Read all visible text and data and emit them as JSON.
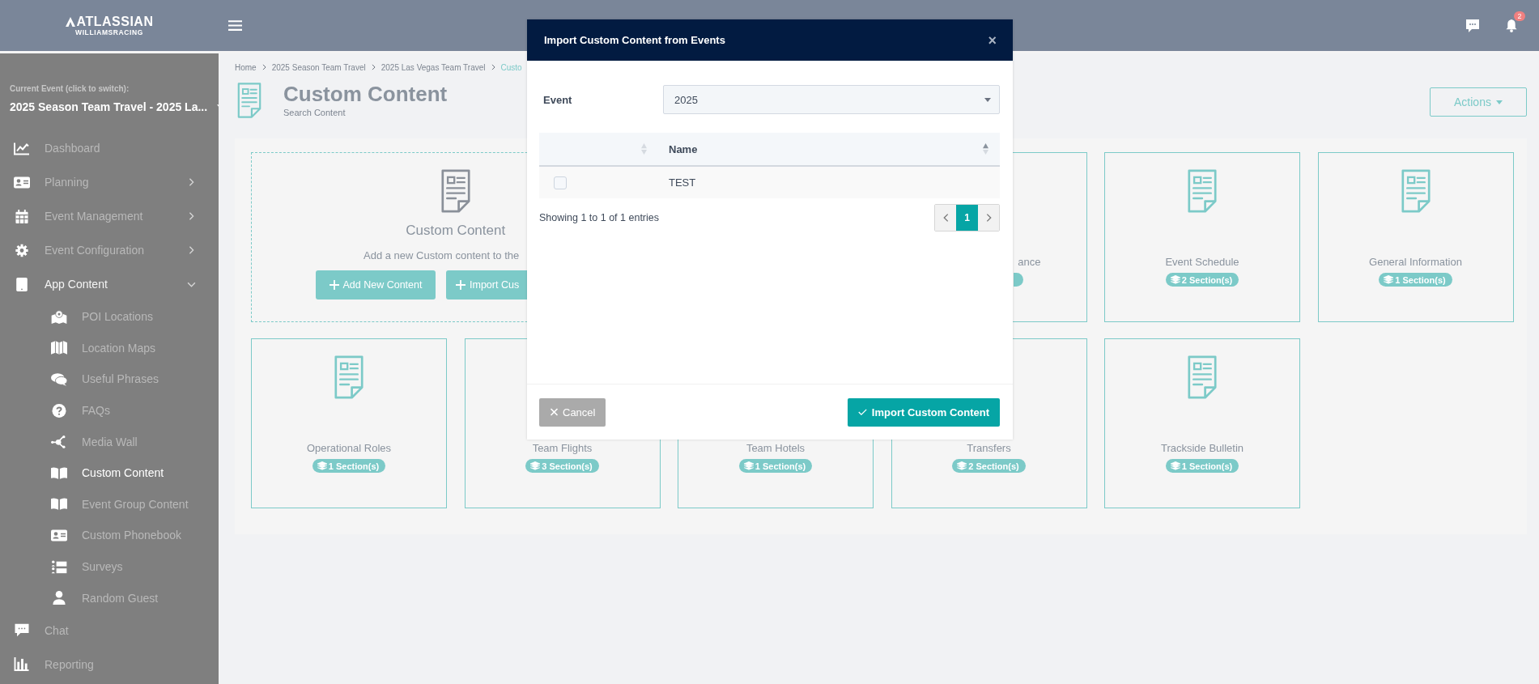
{
  "header": {
    "logo_line_1": "ATLASSIAN",
    "logo_line_2": "WILLIAMSRACING",
    "notification_count": "2"
  },
  "sidebar": {
    "current_event_label": "Current Event (click to switch):",
    "current_event": "2025 Season Team Travel - 2025 La...",
    "menu": [
      {
        "label": "Dashboard",
        "selected": false
      },
      {
        "label": "Planning",
        "selected": false,
        "expanded": false
      },
      {
        "label": "Event Management",
        "selected": false,
        "expanded": false
      },
      {
        "label": "Event Configuration",
        "selected": false,
        "expanded": false
      },
      {
        "label": "App Content",
        "selected": false,
        "expanded": true,
        "children": [
          {
            "label": "POI Locations",
            "selected": false
          },
          {
            "label": "Location Maps",
            "selected": false
          },
          {
            "label": "Useful Phrases",
            "selected": false
          },
          {
            "label": "FAQs",
            "selected": false
          },
          {
            "label": "Media Wall",
            "selected": false
          },
          {
            "label": "Custom Content",
            "selected": true
          },
          {
            "label": "Event Group Content",
            "selected": false
          },
          {
            "label": "Custom Phonebook",
            "selected": false
          },
          {
            "label": "Surveys",
            "selected": false
          },
          {
            "label": "Random Guest",
            "selected": false
          }
        ]
      },
      {
        "label": "Chat",
        "selected": false
      },
      {
        "label": "Reporting",
        "selected": false
      }
    ]
  },
  "page": {
    "breadcrumb": [
      "Home",
      "2025 Season Team Travel",
      "2025 Las Vegas Team Travel",
      "Custo"
    ],
    "title": "Custom Content",
    "subtitle": "Search Content",
    "actions_button": "Actions",
    "add_panel": {
      "title": "Custom Content",
      "text": "Add a new Custom content to the",
      "buttons": [
        "Add New Content",
        "Import Cus"
      ]
    },
    "cards": [
      {
        "kind": "partial",
        "label": "ance"
      },
      {
        "kind": "full",
        "label": "Event Schedule",
        "sections": "2 Section(s)"
      },
      {
        "kind": "full",
        "label": "General Information",
        "sections": "1 Section(s)"
      },
      {
        "kind": "full",
        "label": "Operational Roles",
        "sections": "1 Section(s)"
      },
      {
        "kind": "covered",
        "label": "Team Flights",
        "sections": "3 Section(s)"
      },
      {
        "kind": "covered",
        "label": "Team Hotels",
        "sections": "1 Section(s)"
      },
      {
        "kind": "covered",
        "label": "Transfers",
        "sections": "2 Section(s)"
      },
      {
        "kind": "full",
        "label": "Trackside Bulletin",
        "sections": "1 Section(s)"
      }
    ]
  },
  "modal": {
    "title": "Import Custom Content from Events",
    "close": "×",
    "event_label": "Event",
    "event_value": "2025",
    "columns": [
      {
        "sorted": false
      },
      {
        "label": "Name",
        "sorted": true
      }
    ],
    "rows": [
      {
        "checked": false,
        "name": "TEST"
      }
    ],
    "info": "Showing 1 to 1 of 1 entries",
    "pages": [
      {
        "label": "1",
        "selected": true
      }
    ],
    "cancel_button": "Cancel",
    "import_button": "Import Custom Content"
  }
}
